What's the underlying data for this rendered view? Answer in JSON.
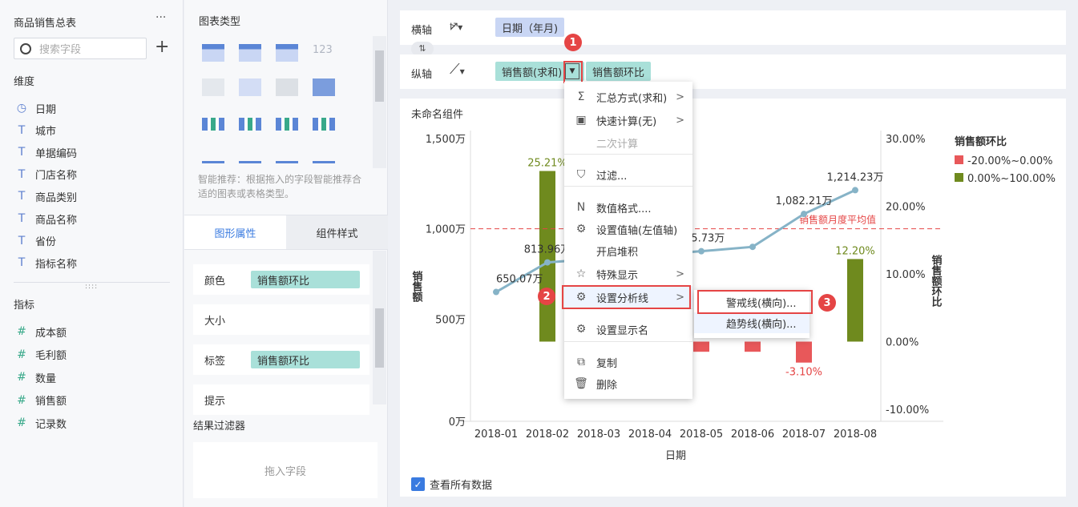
{
  "left": {
    "title": "商品销售总表",
    "more": "···",
    "search_placeholder": "搜索字段",
    "add": "+",
    "dim_header": "维度",
    "dimensions": [
      {
        "icon": "clock-icon",
        "glyph": "◷",
        "label": "日期"
      },
      {
        "icon": "text-field-icon",
        "glyph": "T",
        "label": "城市"
      },
      {
        "icon": "text-field-icon",
        "glyph": "T",
        "label": "单据编码"
      },
      {
        "icon": "text-field-icon",
        "glyph": "T",
        "label": "门店名称"
      },
      {
        "icon": "text-field-icon",
        "glyph": "T",
        "label": "商品类别"
      },
      {
        "icon": "text-field-icon",
        "glyph": "T",
        "label": "商品名称"
      },
      {
        "icon": "text-field-icon",
        "glyph": "T",
        "label": "省份"
      },
      {
        "icon": "text-field-icon",
        "glyph": "T",
        "label": "指标名称"
      }
    ],
    "metric_header": "指标",
    "metrics": [
      {
        "glyph": "#",
        "label": "成本额"
      },
      {
        "glyph": "#",
        "label": "毛利额"
      },
      {
        "glyph": "#",
        "label": "数量"
      },
      {
        "glyph": "#",
        "label": "销售额"
      },
      {
        "glyph": "#",
        "label": "记录数"
      }
    ]
  },
  "mid": {
    "chart_types_title": "图表类型",
    "recommend": "智能推荐：根据拖入的字段智能推荐合适的图表或表格类型。",
    "tab_props": "图形属性",
    "tab_style": "组件样式",
    "props": [
      {
        "label": "颜色",
        "pill": "销售额环比"
      },
      {
        "label": "大小",
        "pill": ""
      },
      {
        "label": "标签",
        "pill": "销售额环比"
      },
      {
        "label": "提示",
        "pill": ""
      }
    ],
    "filter_title": "结果过滤器",
    "filter_drop": "拖入字段"
  },
  "axes": {
    "x_label": "横轴",
    "x_field": "日期（年月)",
    "y_label": "纵轴",
    "y_field1": "销售额(求和)",
    "y_field2": "销售额环比",
    "swap": "⇅"
  },
  "widget": {
    "title": "未命名组件",
    "show_all": "查看所有数据"
  },
  "menu": {
    "items": [
      {
        "icon": "sigma-icon",
        "glyph": "Σ",
        "label": "汇总方式(求和)",
        "arrow": ">"
      },
      {
        "icon": "quick-calc-icon",
        "glyph": "▣",
        "label": "快速计算(无)",
        "arrow": ">"
      },
      {
        "icon": "",
        "glyph": "",
        "label": "二次计算",
        "arrow": ""
      },
      {
        "icon": "filter-icon",
        "glyph": "⛉",
        "label": "过滤...",
        "arrow": ""
      },
      {
        "icon": "number-format-icon",
        "glyph": "N",
        "label": "数值格式....",
        "arrow": ""
      },
      {
        "icon": "gear-icon",
        "glyph": "⚙",
        "label": "设置值轴(左值轴)",
        "arrow": ""
      },
      {
        "icon": "",
        "glyph": "",
        "label": "开启堆积",
        "arrow": ""
      },
      {
        "icon": "star-icon",
        "glyph": "☆",
        "label": "特殊显示",
        "arrow": ">"
      },
      {
        "icon": "gear-icon",
        "glyph": "⚙",
        "label": "设置分析线",
        "arrow": ">"
      },
      {
        "icon": "gear-icon",
        "glyph": "⚙",
        "label": "设置显示名",
        "arrow": ""
      },
      {
        "icon": "copy-icon",
        "glyph": "⧉",
        "label": "复制",
        "arrow": ""
      },
      {
        "icon": "trash-icon",
        "glyph": "🗑",
        "label": "删除",
        "arrow": ""
      }
    ],
    "submenu": [
      "警戒线(横向)...",
      "趋势线(横向)..."
    ]
  },
  "callouts": [
    "1",
    "2",
    "3"
  ],
  "chart_data": {
    "type": "bar",
    "categories": [
      "2018-01",
      "2018-02",
      "2018-03",
      "2018-04",
      "2018-05",
      "2018-06",
      "2018-07",
      "2018-08"
    ],
    "xlabel": "日期",
    "ylabel": "销售额",
    "y2label": "销售额环比",
    "yticks": [
      "1,500万",
      "1,000万",
      "500万",
      "0万"
    ],
    "y2ticks": [
      "30.00%",
      "20.00%",
      "10.00%",
      "0.00%",
      "-10.00%"
    ],
    "ylim": [
      0,
      1500
    ],
    "y2lim": [
      -10,
      30
    ],
    "series": [
      {
        "name": "销售额",
        "type": "line",
        "values": [
          650.07,
          813.96,
          null,
          null,
          875.73,
          null,
          1082.21,
          1214.23
        ],
        "labels": [
          "650.07万",
          "813.96万",
          "",
          "",
          "875.73万",
          "",
          "1,082.21万",
          "1,214.23万"
        ]
      },
      {
        "name": "销售额环比",
        "type": "bar",
        "values": [
          null,
          25.21,
          null,
          null,
          -1.5,
          -1.5,
          -3.1,
          12.2
        ],
        "labels": [
          "",
          "25.21%",
          "",
          "",
          "",
          "",
          "-3.10%",
          "12.20%"
        ]
      }
    ],
    "line_extra_y": [
      null,
      null,
      null,
      null,
      null,
      900,
      null,
      null
    ],
    "ref_line": {
      "label": "销售额月度平均值",
      "value": 1000
    },
    "legend_title": "销售额环比",
    "legend": [
      {
        "label": "-20.00%~0.00%",
        "color": "#e8585a"
      },
      {
        "label": "0.00%~100.00%",
        "color": "#6f8a1e"
      }
    ],
    "colors": {
      "line": "#86b3c7",
      "bar_pos": "#6f8a1e",
      "bar_neg": "#e8585a",
      "ref": "#e54545"
    }
  }
}
